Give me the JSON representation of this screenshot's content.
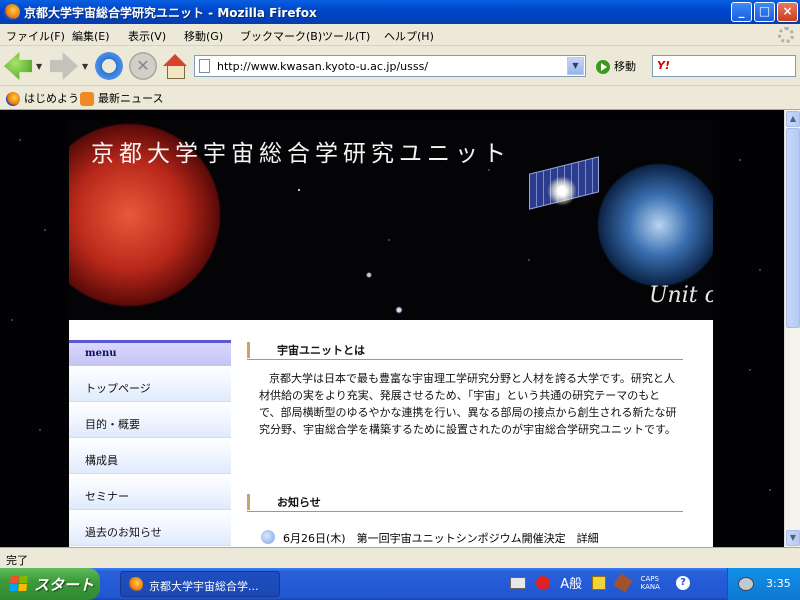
{
  "window": {
    "title": "京都大学宇宙総合学研究ユニット - Mozilla Firefox",
    "min_glyph": "_",
    "max_glyph": "□",
    "close_glyph": "×"
  },
  "menu": {
    "items": [
      {
        "label": "ファイル(F)"
      },
      {
        "label": "編集(E)"
      },
      {
        "label": "表示(V)"
      },
      {
        "label": "移動(G)"
      },
      {
        "label": "ブックマーク(B)"
      },
      {
        "label": "ツール(T)"
      },
      {
        "label": "ヘルプ(H)"
      }
    ]
  },
  "nav": {
    "url": "http://www.kwasan.kyoto-u.ac.jp/usss/",
    "go_label": "移動",
    "search_engine_label": "Y!",
    "stop_glyph": "✕",
    "dropdown_glyph": "▼"
  },
  "bookmarks": {
    "items": [
      {
        "label": "はじめよう",
        "icon": "firefox-icon"
      },
      {
        "label": "最新ニュース",
        "icon": "rss-icon"
      }
    ]
  },
  "site": {
    "banner_title": "京都大学宇宙総合学研究ユニット",
    "banner_subtitle": "Unit o",
    "menu_heading": "menu",
    "menu_items": [
      {
        "label": "トップページ"
      },
      {
        "label": "目的・概要"
      },
      {
        "label": "構成員"
      },
      {
        "label": "セミナー"
      },
      {
        "label": "過去のお知らせ"
      }
    ],
    "about_heading": "宇宙ユニットとは",
    "about_text": "京都大学は日本で最も豊富な宇宙理工学研究分野と人材を誇る大学です。研究と人材供給の実をより充実、発展させるため、「宇宙」という共通の研究テーマのもとで、部局横断型のゆるやかな連携を行い、異なる部局の接点から創生される新たな研究分野、宇宙総合学を構築するために設置されたのが宇宙総合学研究ユニットです。",
    "news_heading": "お知らせ",
    "news_items": [
      {
        "text": "6月26日(木)　第一回宇宙ユニットシンポジウム開催決定　詳細"
      }
    ]
  },
  "status": {
    "text": "完了"
  },
  "taskbar": {
    "start_label": "スタート",
    "task_label": "京都大学宇宙総合学...",
    "ime_mode": "A般",
    "caps_label": "CAPS",
    "kana_label": "KANA",
    "help_glyph": "?",
    "clock": "3:35"
  },
  "scrollbar": {
    "up_glyph": "▲",
    "down_glyph": "▼"
  }
}
